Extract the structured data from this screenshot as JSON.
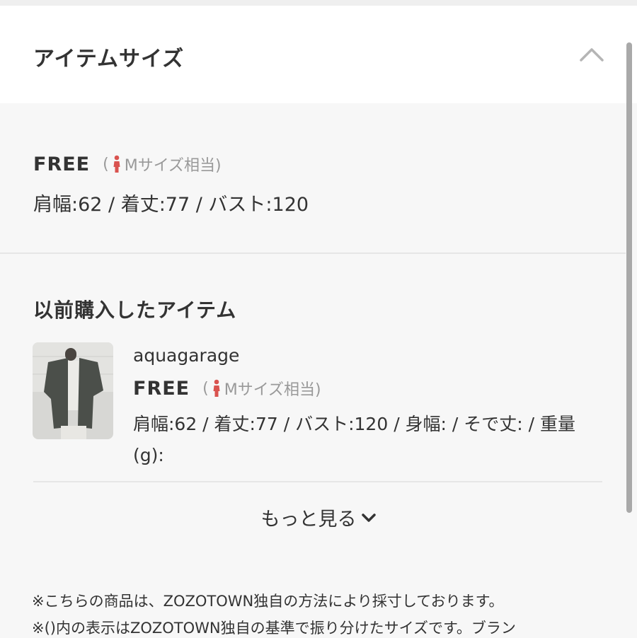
{
  "header": {
    "title": "アイテムサイズ"
  },
  "size": {
    "label": "FREE",
    "note_open": "(",
    "note_text": "Mサイズ相当)",
    "measurements": "肩幅:62 / 着丈:77 / バスト:120"
  },
  "previous": {
    "section_title": "以前購入したアイテム",
    "brand": "aquagarage",
    "size_label": "FREE",
    "note_open": "(",
    "note_text": "Mサイズ相当)",
    "measurements": "肩幅:62 / 着丈:77 / バスト:120 / 身幅: / そで丈: / 重量(g):"
  },
  "more": {
    "label": "もっと見る"
  },
  "notes": {
    "line1": "※こちらの商品は、ZOZOTOWN独自の方法により採寸しております。",
    "line2": "※()内の表示はZOZOTOWN独自の基準で振り分けたサイズです。ブラン"
  },
  "colors": {
    "accent_icon": "#d9534f",
    "text": "#333333",
    "muted": "#999999"
  },
  "icons": {
    "collapse": "chevron-up-icon",
    "expand": "chevron-down-icon",
    "size_person": "woman-icon"
  }
}
